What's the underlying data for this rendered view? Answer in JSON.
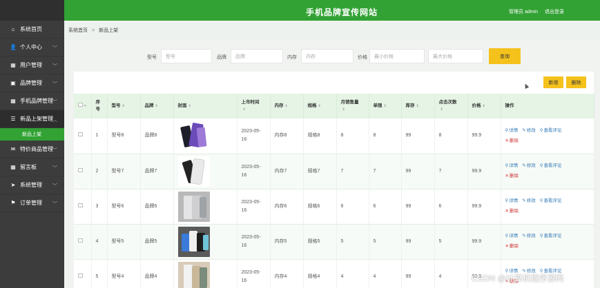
{
  "header": {
    "title": "手机品牌宣传网站",
    "user": "管理员 admin",
    "logout": "退出登录"
  },
  "sidebar": {
    "items": [
      {
        "label": "系统首页",
        "icon": "⌂"
      },
      {
        "label": "个人中心",
        "icon": "👤"
      },
      {
        "label": "用户管理",
        "icon": "▦"
      },
      {
        "label": "品牌管理",
        "icon": "▣"
      },
      {
        "label": "手机品牌管理",
        "icon": "▦"
      },
      {
        "label": "新品上架管理",
        "icon": "☰"
      },
      {
        "label": "特价商品管理",
        "icon": "✉"
      },
      {
        "label": "留言板",
        "icon": "▦"
      },
      {
        "label": "系统管理",
        "icon": "➤"
      },
      {
        "label": "订单管理",
        "icon": "⚑"
      }
    ],
    "sub": {
      "label": "新品上架"
    }
  },
  "breadcrumb": {
    "home": "系统首页",
    "sep": ">",
    "current": "新品上架"
  },
  "search": {
    "model_label": "型号",
    "model_ph": "型号",
    "brand_label": "品牌",
    "brand_ph": "品牌",
    "memory_label": "内存",
    "memory_ph": "内存",
    "price_label": "价格",
    "price_min_ph": "最小价格",
    "price_max_ph": "最大价格",
    "query_btn": "查询"
  },
  "toolbar": {
    "add": "新增",
    "delete": "删除"
  },
  "table": {
    "headers": [
      "序号",
      "型号",
      "品牌",
      "封面",
      "上市时间",
      "内存",
      "规格",
      "月销售量",
      "单限",
      "库存",
      "点击次数",
      "价格",
      "操作"
    ],
    "actions": {
      "detail": "详情",
      "edit": "修改",
      "comments": "查看评论",
      "delete": "删除"
    },
    "rows": [
      {
        "idx": "1",
        "model": "型号8",
        "brand": "品牌8",
        "date": "2023-05-16",
        "mem": "内存8",
        "spec": "规格8",
        "sales": "8",
        "limit": "8",
        "stock": "99",
        "clicks": "8",
        "price": "99.9",
        "img": "purple"
      },
      {
        "idx": "2",
        "model": "型号7",
        "brand": "品牌7",
        "date": "2023-05-16",
        "mem": "内存7",
        "spec": "规格7",
        "sales": "7",
        "limit": "7",
        "stock": "99",
        "clicks": "7",
        "price": "99.9",
        "img": "white"
      },
      {
        "idx": "3",
        "model": "型号6",
        "brand": "品牌6",
        "date": "2023-05-16",
        "mem": "内存6",
        "spec": "规格6",
        "sales": "6",
        "limit": "6",
        "stock": "99",
        "clicks": "6",
        "price": "99.9",
        "img": "gray"
      },
      {
        "idx": "4",
        "model": "型号5",
        "brand": "品牌5",
        "date": "2023-05-16",
        "mem": "内存5",
        "spec": "规格5",
        "sales": "5",
        "limit": "5",
        "stock": "99",
        "clicks": "5",
        "price": "99.9",
        "img": "dark"
      },
      {
        "idx": "5",
        "model": "型号4",
        "brand": "品牌4",
        "date": "2023-05-16",
        "mem": "内存4",
        "spec": "规格4",
        "sales": "4",
        "limit": "4",
        "stock": "99",
        "clicks": "4",
        "price": "99.9",
        "img": "beige"
      }
    ]
  },
  "watermark": "CSDN @计算机程序源码"
}
